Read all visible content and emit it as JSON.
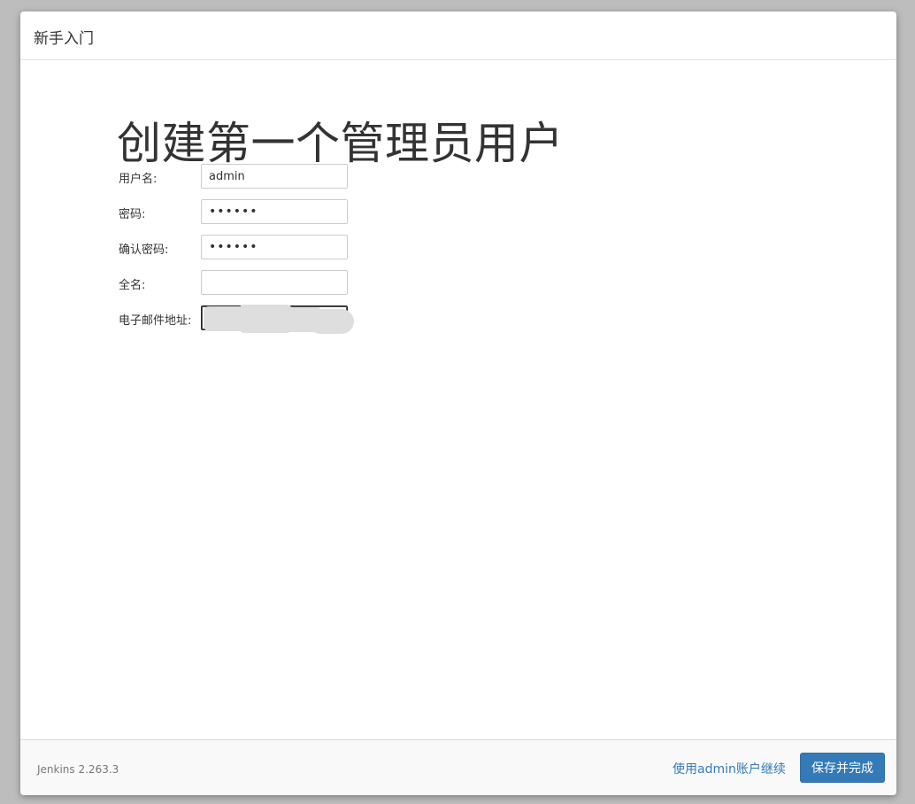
{
  "header": {
    "title": "新手入门"
  },
  "main": {
    "title": "创建第一个管理员用户",
    "fields": {
      "username": {
        "label": "用户名:",
        "value": "admin"
      },
      "password": {
        "label": "密码:",
        "value": "••••••"
      },
      "confirm_password": {
        "label": "确认密码:",
        "value": "••••••"
      },
      "full_name": {
        "label": "全名:",
        "value": ""
      },
      "email": {
        "label": "电子邮件地址:",
        "value": ""
      }
    }
  },
  "footer": {
    "version": "Jenkins 2.263.3",
    "skip_link": "使用admin账户继续",
    "save_button": "保存并完成"
  },
  "colors": {
    "primary": "#337ab7",
    "overlay": "#bdbdbd"
  }
}
